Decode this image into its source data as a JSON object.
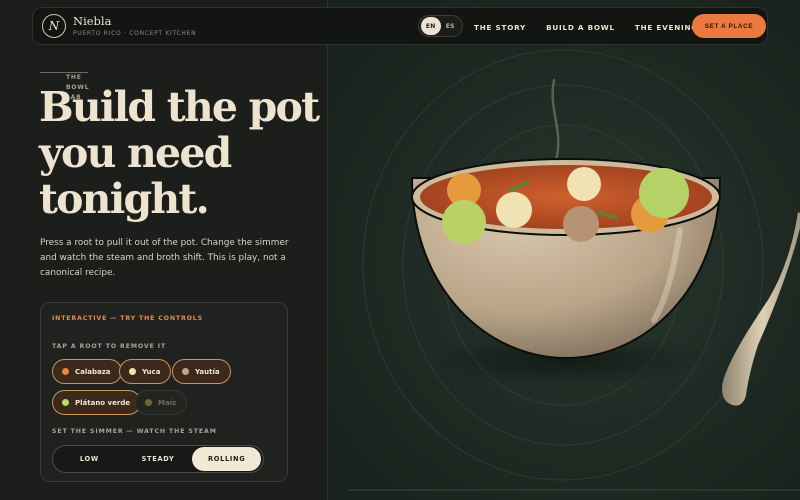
{
  "header": {
    "brand_name": "Niebla",
    "brand_sub": "PUERTO RICO · CONCEPT KITCHEN",
    "logo_letter": "N",
    "lang": {
      "en": "EN",
      "es": "ES",
      "active": "EN"
    },
    "nav": [
      "THE STORY",
      "BUILD A BOWL",
      "THE EVENING"
    ],
    "cta_label": "SET A PLACE"
  },
  "hero": {
    "eyebrow": "THE BOWL LAB",
    "headline": "Build the pot you need tonight.",
    "intro": "Press a root to pull it out of the pot. Change the simmer and watch the steam and broth shift. This is play, not a canonical recipe."
  },
  "controls": {
    "title": "INTERACTIVE — TRY THE CONTROLS",
    "roots_label": "TAP A ROOT TO REMOVE IT",
    "roots": [
      {
        "label": "Calabaza",
        "color": "#e8883a",
        "active": true
      },
      {
        "label": "Yuca",
        "color": "#f2e2b5",
        "active": true
      },
      {
        "label": "Yautía",
        "color": "#c8a08a",
        "active": true
      },
      {
        "label": "Plátano verde",
        "color": "#c3d66a",
        "active": true
      },
      {
        "label": "Maíz",
        "color": "#6a6a2e",
        "active": false
      }
    ],
    "simmer_label": "SET THE SIMMER — WATCH THE STEAM",
    "simmer": [
      "LOW",
      "STEADY",
      "ROLLING"
    ],
    "simmer_active": "ROLLING"
  },
  "colors": {
    "accent": "#ea7a3e",
    "cream": "#ede3cf",
    "broth": "#c9592a",
    "bowl": "#c8b59a"
  }
}
